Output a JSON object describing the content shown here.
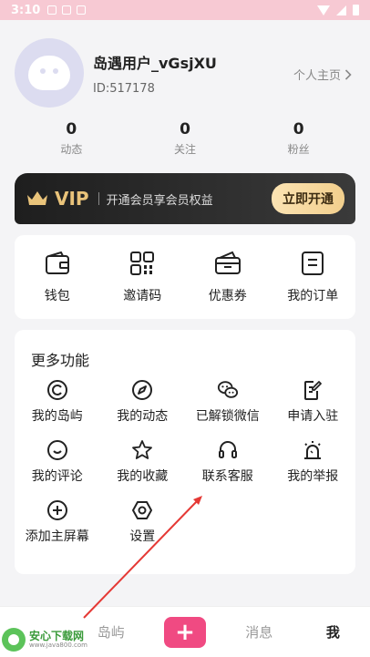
{
  "status_bar": {
    "time": "3:10"
  },
  "profile": {
    "username": "岛遇用户_vGsjXU",
    "user_id": "ID:517178",
    "homepage_link": "个人主页",
    "stats": [
      {
        "value": "0",
        "label": "动态"
      },
      {
        "value": "0",
        "label": "关注"
      },
      {
        "value": "0",
        "label": "粉丝"
      }
    ]
  },
  "vip": {
    "badge": "VIP",
    "description": "开通会员享会员权益",
    "button": "立即开通",
    "accent_color": "#e9c37a"
  },
  "quick_actions": [
    {
      "label": "钱包",
      "icon": "wallet-icon"
    },
    {
      "label": "邀请码",
      "icon": "qr-code-icon"
    },
    {
      "label": "优惠券",
      "icon": "coupon-icon"
    },
    {
      "label": "我的订单",
      "icon": "order-icon"
    }
  ],
  "more": {
    "title": "更多功能",
    "items": [
      {
        "label": "我的岛屿",
        "icon": "island-icon"
      },
      {
        "label": "我的动态",
        "icon": "compass-icon"
      },
      {
        "label": "已解锁微信",
        "icon": "wechat-icon"
      },
      {
        "label": "申请入驻",
        "icon": "edit-note-icon"
      },
      {
        "label": "我的评论",
        "icon": "comment-icon"
      },
      {
        "label": "我的收藏",
        "icon": "star-icon"
      },
      {
        "label": "联系客服",
        "icon": "headset-icon"
      },
      {
        "label": "我的举报",
        "icon": "alarm-icon"
      },
      {
        "label": "添加主屏幕",
        "icon": "plus-circle-icon"
      },
      {
        "label": "设置",
        "icon": "settings-icon"
      }
    ]
  },
  "tabbar": {
    "tabs": [
      {
        "label": ""
      },
      {
        "label": "岛屿"
      },
      {
        "label": "+"
      },
      {
        "label": "消息"
      },
      {
        "label": "我"
      }
    ],
    "accent_color": "#f04a82"
  },
  "watermark": {
    "title": "安心下载网",
    "url": "www.java800.com"
  }
}
